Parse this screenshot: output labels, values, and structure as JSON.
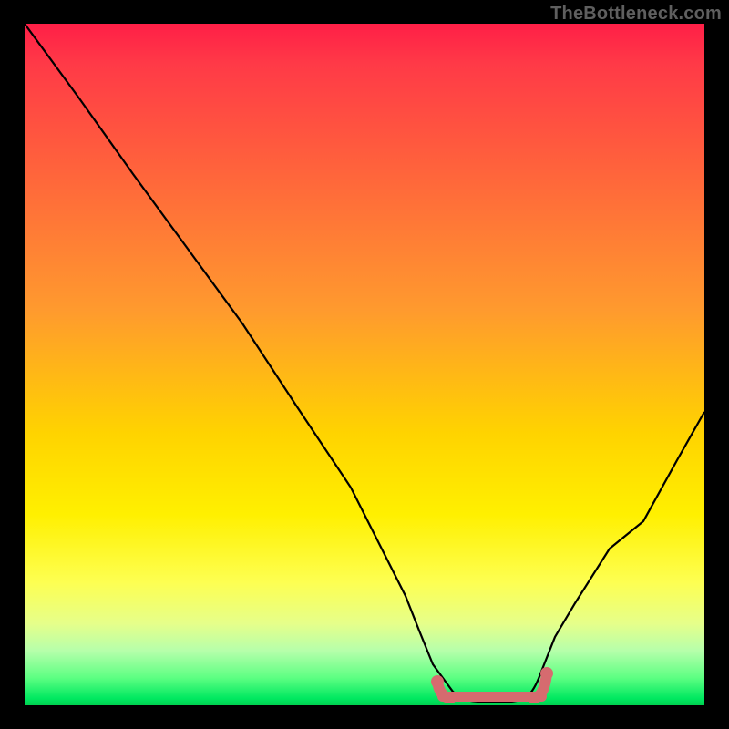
{
  "watermark": "TheBottleneck.com",
  "chart_data": {
    "type": "line",
    "title": "",
    "xlabel": "",
    "ylabel": "",
    "xlim": [
      0,
      100
    ],
    "ylim": [
      0,
      100
    ],
    "grid": false,
    "series": [
      {
        "name": "bottleneck-curve",
        "x": [
          0,
          8,
          16,
          24,
          32,
          40,
          48,
          56,
          58,
          60,
          63,
          67,
          71,
          74,
          76,
          78,
          81,
          86,
          91,
          96,
          100
        ],
        "y": [
          100,
          89,
          78,
          67,
          56,
          44,
          32,
          16,
          11,
          6,
          2,
          0.5,
          0.4,
          0.5,
          2,
          5,
          10,
          18,
          27,
          36,
          43
        ]
      }
    ],
    "markers": {
      "optimal_band": {
        "shape": "rounded-segment",
        "color": "#d66b6f",
        "x_start": 60,
        "x_end": 77,
        "y": 0.7
      }
    },
    "background_gradient": {
      "top": "#ff1f47",
      "mid": "#fff000",
      "bottom": "#00d050"
    }
  }
}
